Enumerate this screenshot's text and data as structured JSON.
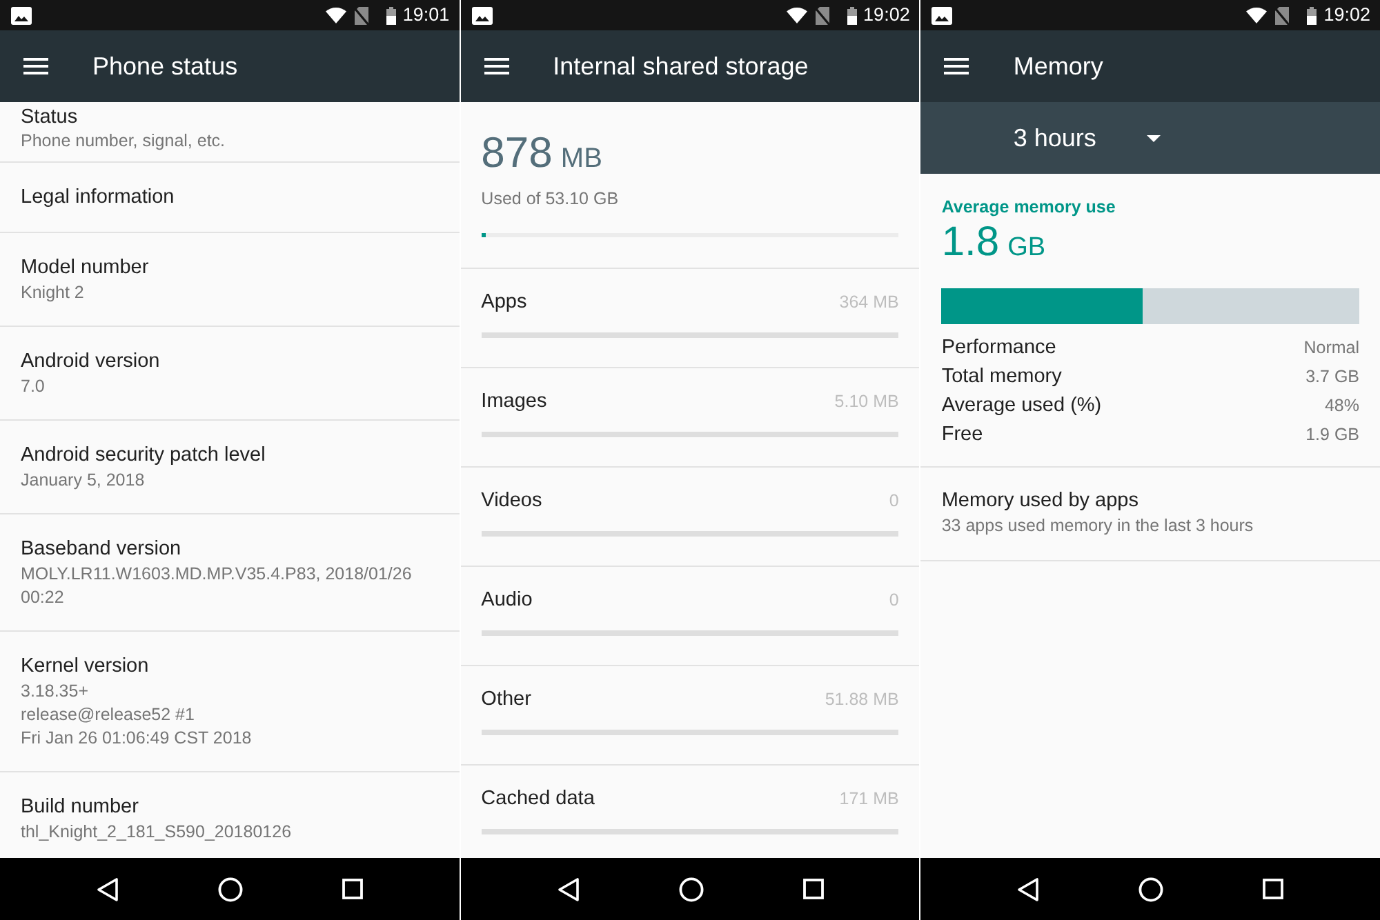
{
  "screens": [
    {
      "kind": "settings_list",
      "status_bar": {
        "time": "19:01"
      },
      "toolbar": {
        "title": "Phone status"
      },
      "items": [
        {
          "title": "Status",
          "summary": [
            "Phone number, signal, etc."
          ]
        },
        {
          "title": "Legal information"
        },
        {
          "title": "Model number",
          "summary": [
            "Knight 2"
          ]
        },
        {
          "title": "Android version",
          "summary": [
            "7.0"
          ]
        },
        {
          "title": "Android security patch level",
          "summary": [
            "January 5, 2018"
          ]
        },
        {
          "title": "Baseband version",
          "summary": [
            "MOLY.LR11.W1603.MD.MP.V35.4.P83, 2018/01/26 00:22"
          ]
        },
        {
          "title": "Kernel version",
          "summary": [
            "3.18.35+",
            "release@release52 #1",
            "Fri Jan 26 01:06:49 CST 2018"
          ]
        },
        {
          "title": "Build number",
          "summary": [
            "thl_Knight_2_181_S590_20180126"
          ]
        }
      ]
    },
    {
      "kind": "storage",
      "status_bar": {
        "time": "19:02"
      },
      "toolbar": {
        "title": "Internal shared storage"
      },
      "summary": {
        "amount": "878",
        "unit": "MB",
        "caption": "Used of 53.10 GB",
        "level": 0.01
      },
      "categories": [
        {
          "label": "Apps",
          "value": "364 MB"
        },
        {
          "label": "Images",
          "value": "5.10 MB"
        },
        {
          "label": "Videos",
          "value": "0"
        },
        {
          "label": "Audio",
          "value": "0"
        },
        {
          "label": "Other",
          "value": "51.88 MB"
        },
        {
          "label": "Cached data",
          "value": "171 MB"
        }
      ]
    },
    {
      "kind": "memory",
      "status_bar": {
        "time": "19:02"
      },
      "toolbar": {
        "title": "Memory"
      },
      "period_selector": {
        "value": "3 hours"
      },
      "average": {
        "label": "Average memory use",
        "amount": "1.8",
        "unit": "GB",
        "level": 0.48
      },
      "stats": [
        {
          "label": "Performance",
          "value": "Normal"
        },
        {
          "label": "Total memory",
          "value": "3.7 GB"
        },
        {
          "label": "Average used (%)",
          "value": "48%"
        },
        {
          "label": "Free",
          "value": "1.9 GB"
        }
      ],
      "items": [
        {
          "title": "Memory used by apps",
          "summary": [
            "33 apps used memory in the last 3 hours"
          ]
        }
      ]
    }
  ]
}
